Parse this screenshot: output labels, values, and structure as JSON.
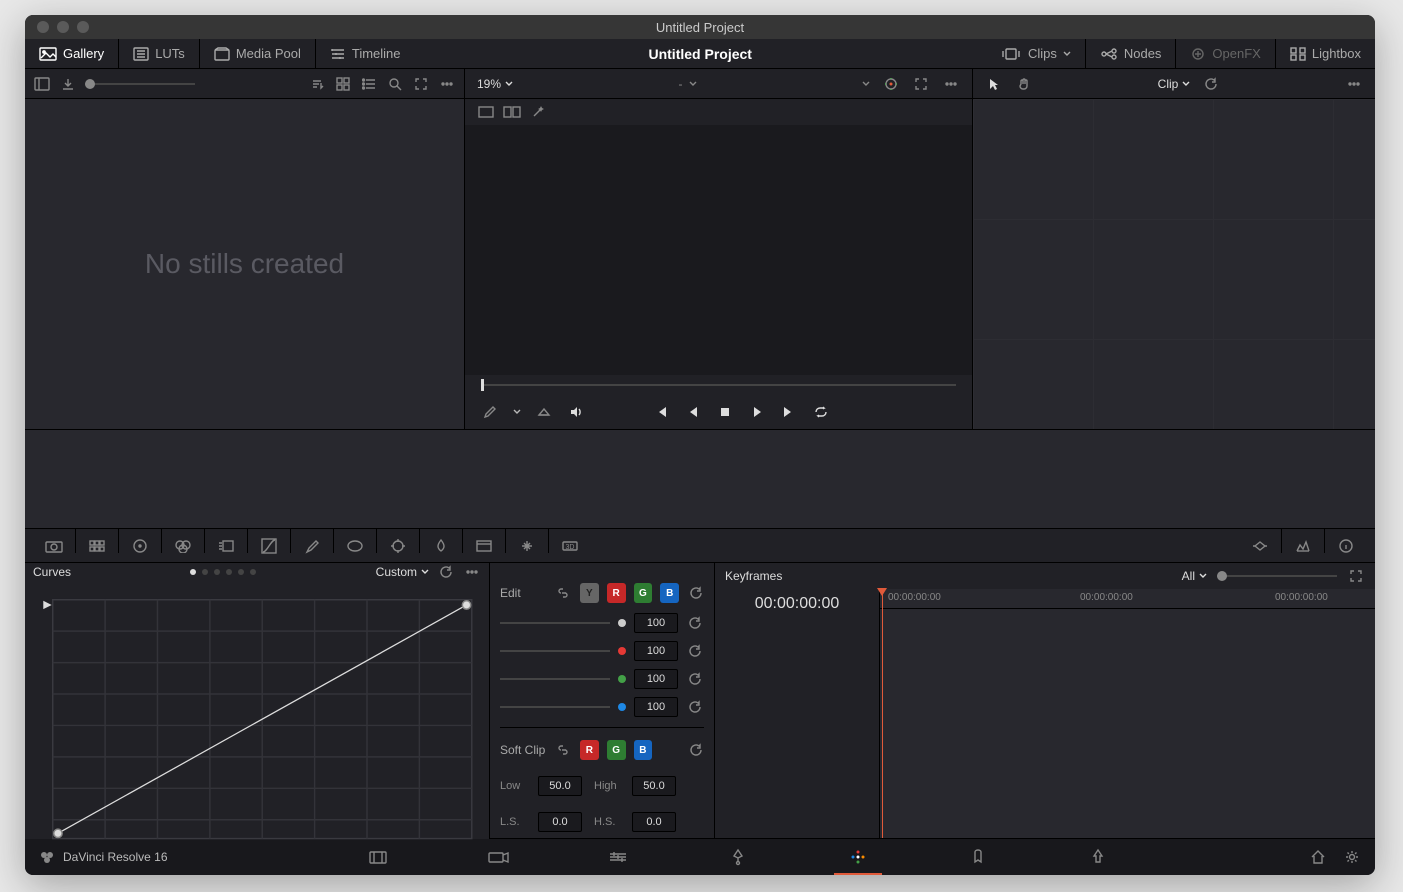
{
  "titlebar": {
    "title": "Untitled Project"
  },
  "toolbar": {
    "gallery": "Gallery",
    "luts": "LUTs",
    "mediapool": "Media Pool",
    "timeline": "Timeline",
    "project_title": "Untitled Project",
    "clips": "Clips",
    "nodes": "Nodes",
    "openfx": "OpenFX",
    "lightbox": "Lightbox"
  },
  "viewer": {
    "zoom": "19%"
  },
  "gallery": {
    "empty": "No stills created"
  },
  "nodes": {
    "label": "Clip"
  },
  "curves": {
    "title": "Curves",
    "mode": "Custom",
    "edit_label": "Edit",
    "channels": {
      "Y": "Y",
      "R": "R",
      "G": "G",
      "B": "B"
    },
    "intensity": {
      "white": "100",
      "red": "100",
      "green": "100",
      "blue": "100"
    },
    "softclip_label": "Soft Clip",
    "softclip_channels": {
      "R": "R",
      "G": "G",
      "B": "B"
    },
    "low_label": "Low",
    "low_val": "50.0",
    "high_label": "High",
    "high_val": "50.0",
    "ls_label": "L.S.",
    "ls_val": "0.0",
    "hs_label": "H.S.",
    "hs_val": "0.0"
  },
  "keyframes": {
    "title": "Keyframes",
    "all": "All",
    "tc_current": "00:00:00:00",
    "ticks": [
      "00:00:00:00",
      "00:00:00:00",
      "00:00:00:00"
    ]
  },
  "bottombar": {
    "app": "DaVinci Resolve 16"
  }
}
